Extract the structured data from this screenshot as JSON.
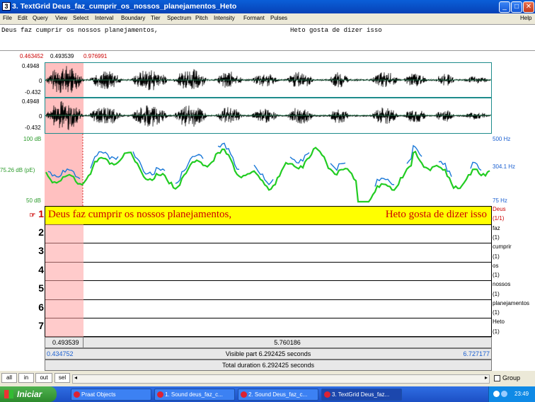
{
  "window": {
    "title": "3. TextGrid Deus_faz_cumprir_os_nossos_planejamentos_Heto",
    "controls": [
      "minimize",
      "maximize",
      "close"
    ]
  },
  "menu": [
    "File",
    "Edit",
    "Query",
    "View",
    "Select",
    "Interval",
    "Boundary",
    "Tier",
    "Spectrum",
    "Pitch",
    "Intensity",
    "Formant",
    "Pulses",
    "Help"
  ],
  "text_window": {
    "segment1": "Deus faz cumprir os nossos planejamentos,",
    "segment2": "Heto gosta de dizer isso"
  },
  "selection": {
    "left_edge": "0.463452",
    "cursor": "0.493539",
    "right_edge": "0.976991"
  },
  "waveform": {
    "ch1_max": "0.4948",
    "ch1_zero": "0",
    "ch1_min": "-0.432",
    "ch2_max": "0.4948",
    "ch2_zero": "0",
    "ch2_min": "-0.432"
  },
  "analysis": {
    "intensity_top": "100 dB",
    "intensity_cursor": "75.26 dB (pE)",
    "intensity_bottom": "50 dB",
    "pitch_top": "500 Hz",
    "pitch_cursor": "304.1 Hz",
    "pitch_bottom": "75 Hz"
  },
  "tiers": [
    {
      "num": "1",
      "name": "Deus",
      "count": "(1/1)"
    },
    {
      "num": "2",
      "name": "faz",
      "count": "(1)"
    },
    {
      "num": "3",
      "name": "cumprir",
      "count": "(1)"
    },
    {
      "num": "4",
      "name": "os",
      "count": "(1)"
    },
    {
      "num": "5",
      "name": "nossos",
      "count": "(1)"
    },
    {
      "num": "6",
      "name": "planejamentos",
      "count": "(1)"
    },
    {
      "num": "7",
      "name": "Heto",
      "count": "(1)"
    }
  ],
  "tier1_text": {
    "part1": "Deus faz cumprir os nossos planejamentos,",
    "part2": "Heto gosta de dizer isso"
  },
  "timebar": {
    "sel_duration": "0.493539",
    "rest_duration": "5.760186",
    "window_start": "0.434752",
    "visible": "Visible part 6.292425 seconds",
    "window_end": "6.727177",
    "total": "Total duration 6.292425 seconds"
  },
  "zoom_buttons": [
    "all",
    "in",
    "out",
    "sel"
  ],
  "group_label": "Group",
  "taskbar": {
    "start_label": "Iniciar",
    "items": [
      "Praat Objects",
      "1. Sound deus_faz_c...",
      "2. Sound Deus_faz_c...",
      "3. TextGrid Deus_faz..."
    ],
    "clock": "23:49"
  },
  "colors": {
    "pitch": "#1a78d8",
    "intensity": "#22cc22",
    "tier1_bg": "#ffff00",
    "tier1_text": "#cc0000",
    "selection": "#ffb0b0",
    "axis_red": "#cc0000",
    "axis_green": "#2a9a2a",
    "axis_blue": "#1a5fd0"
  }
}
